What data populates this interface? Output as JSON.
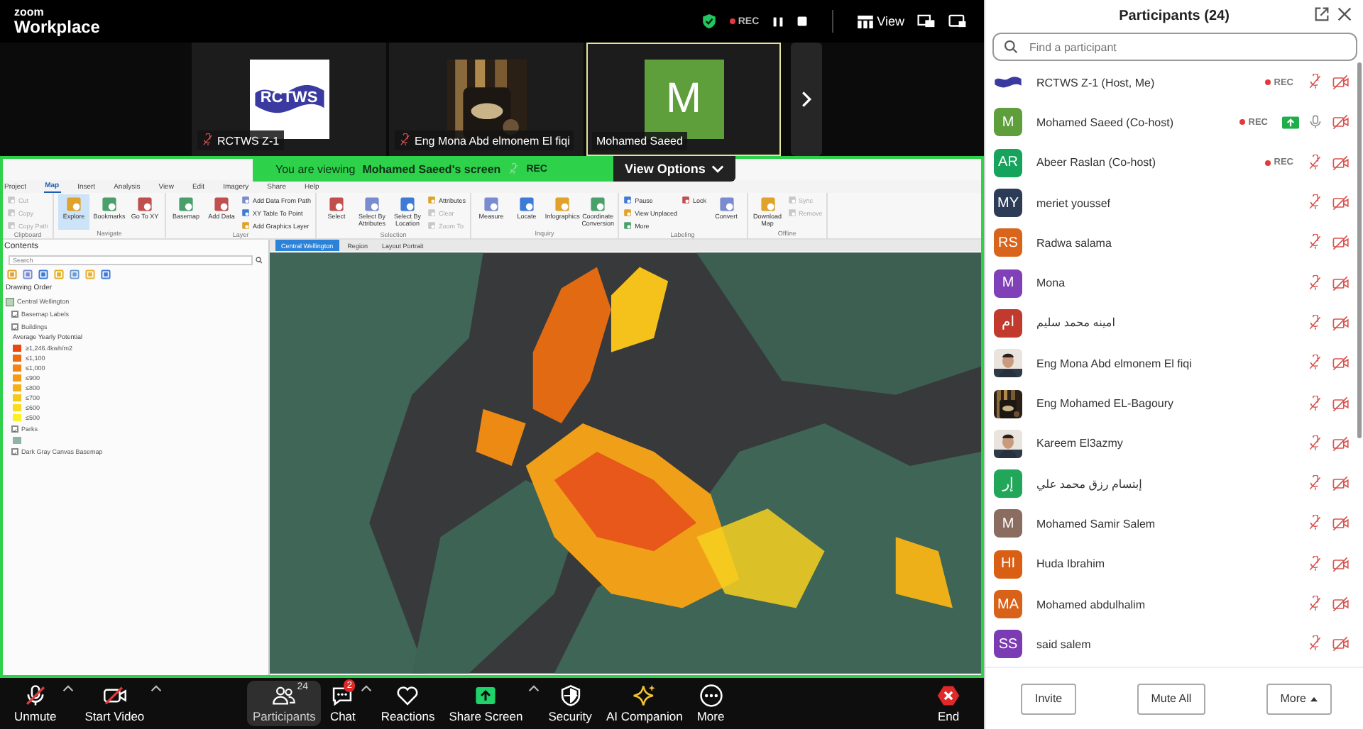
{
  "app": {
    "brand_small": "zoom",
    "brand_large": "Workplace"
  },
  "top_bar": {
    "rec_label": "REC",
    "view_label": "View"
  },
  "video_tiles": [
    {
      "name": "RCTWS Z-1",
      "kind": "logo",
      "logo_text": "RCTWS",
      "muted": true,
      "selected": false
    },
    {
      "name": "Eng Mona Abd elmonem El fiqi",
      "muted": true,
      "selected": false
    },
    {
      "name": "Mohamed Saeed",
      "kind": "initials",
      "initials": "M",
      "color": "#5e9e3b",
      "muted": false,
      "selected": true
    }
  ],
  "share_banner": {
    "prefix": "You are viewing",
    "sharer": "Mohamed Saeed's screen",
    "rec_label": "REC",
    "options_label": "View Options"
  },
  "shared_app": {
    "ribbon_tabs": [
      {
        "label": "Project",
        "selected": false
      },
      {
        "label": "Map",
        "selected": true
      },
      {
        "label": "Insert",
        "selected": false
      },
      {
        "label": "Analysis",
        "selected": false
      },
      {
        "label": "View",
        "selected": false
      },
      {
        "label": "Edit",
        "selected": false
      },
      {
        "label": "Imagery",
        "selected": false
      },
      {
        "label": "Share",
        "selected": false
      },
      {
        "label": "Help",
        "selected": false
      }
    ],
    "ribbon_groups": [
      {
        "label": "Clipboard",
        "items": [
          {
            "label": "Cut",
            "kind": "small",
            "disabled": true,
            "selected": false
          },
          {
            "label": "Copy",
            "kind": "small",
            "disabled": true,
            "selected": false
          },
          {
            "label": "Copy Path",
            "kind": "small",
            "disabled": true,
            "selected": false
          }
        ]
      },
      {
        "label": "Navigate",
        "items": [
          {
            "label": "Explore",
            "kind": "large",
            "disabled": false,
            "selected": true
          },
          {
            "label": "Bookmarks",
            "kind": "large",
            "disabled": false,
            "selected": false
          },
          {
            "label": "Go To XY",
            "kind": "large",
            "disabled": false,
            "selected": false
          }
        ]
      },
      {
        "label": "Layer",
        "items": [
          {
            "label": "Basemap",
            "kind": "large",
            "disabled": false,
            "selected": false
          },
          {
            "label": "Add Data",
            "kind": "large",
            "disabled": false,
            "selected": false
          },
          {
            "label": "Add Data From Path",
            "kind": "small",
            "disabled": false,
            "selected": false
          },
          {
            "label": "XY Table To Point",
            "kind": "small",
            "disabled": false,
            "selected": false
          },
          {
            "label": "Add Graphics Layer",
            "kind": "small",
            "disabled": false,
            "selected": false
          }
        ]
      },
      {
        "label": "Selection",
        "items": [
          {
            "label": "Select",
            "kind": "large",
            "disabled": false,
            "selected": false
          },
          {
            "label": "Select By Attributes",
            "kind": "large",
            "disabled": false,
            "selected": false
          },
          {
            "label": "Select By Location",
            "kind": "large",
            "disabled": false,
            "selected": false
          },
          {
            "label": "Attributes",
            "kind": "small",
            "disabled": false,
            "selected": false
          },
          {
            "label": "Clear",
            "kind": "small",
            "disabled": true,
            "selected": false
          },
          {
            "label": "Zoom To",
            "kind": "small",
            "disabled": true,
            "selected": false
          }
        ]
      },
      {
        "label": "Inquiry",
        "items": [
          {
            "label": "Measure",
            "kind": "large",
            "disabled": false,
            "selected": false
          },
          {
            "label": "Locate",
            "kind": "large",
            "disabled": false,
            "selected": false
          },
          {
            "label": "Infographics",
            "kind": "large",
            "disabled": false,
            "selected": false
          },
          {
            "label": "Coordinate Conversion",
            "kind": "large",
            "disabled": false,
            "selected": false
          }
        ]
      },
      {
        "label": "Labeling",
        "items": [
          {
            "label": "Pause",
            "kind": "small",
            "disabled": false,
            "selected": false
          },
          {
            "label": "View Unplaced",
            "kind": "small",
            "disabled": false,
            "selected": false
          },
          {
            "label": "More",
            "kind": "small",
            "disabled": false,
            "selected": false
          },
          {
            "label": "Lock",
            "kind": "small",
            "disabled": false,
            "selected": false
          },
          {
            "label": "Convert",
            "kind": "large",
            "disabled": false,
            "selected": false
          }
        ]
      },
      {
        "label": "Offline",
        "items": [
          {
            "label": "Download Map",
            "kind": "large",
            "disabled": false,
            "selected": false
          },
          {
            "label": "Sync",
            "kind": "small",
            "disabled": true,
            "selected": false
          },
          {
            "label": "Remove",
            "kind": "small",
            "disabled": true,
            "selected": false
          }
        ]
      }
    ],
    "contents": {
      "title": "Contents",
      "search_placeholder": "Search",
      "heading": "Drawing Order",
      "map_name": "Central Wellington",
      "layers": [
        {
          "name": "Basemap Labels",
          "checked": true
        },
        {
          "name": "Buildings",
          "checked": true,
          "legend_title": "Average Yearly Potential",
          "classes": [
            {
              "label": "≥1,246.4kwh/m2",
              "color": "#e8480f"
            },
            {
              "label": "≤1,100",
              "color": "#ee6a10"
            },
            {
              "label": "≤1,000",
              "color": "#f28413"
            },
            {
              "label": "≤900",
              "color": "#f59a14"
            },
            {
              "label": "≤800",
              "color": "#f6b017"
            },
            {
              "label": "≤700",
              "color": "#f8c819"
            },
            {
              "label": "≤600",
              "color": "#fadc1c"
            },
            {
              "label": "≤500",
              "color": "#fcef22"
            }
          ]
        },
        {
          "name": "Parks",
          "checked": true,
          "classes": [
            {
              "color": "#8fb3a6"
            }
          ]
        },
        {
          "name": "Dark Gray Canvas Basemap",
          "checked": true
        }
      ]
    },
    "map_tabs": [
      {
        "label": "Central Wellington",
        "selected": true
      },
      {
        "label": "Region",
        "selected": false
      },
      {
        "label": "Layout Portrait",
        "selected": false
      }
    ]
  },
  "toolbar": [
    {
      "label": "Unmute",
      "caret": true,
      "selected": false
    },
    {
      "label": "Start Video",
      "caret": true,
      "selected": false
    },
    {
      "label": "Participants",
      "count": "24",
      "selected": true
    },
    {
      "label": "Chat",
      "badge": "2",
      "caret": true,
      "selected": false
    },
    {
      "label": "Reactions",
      "selected": false
    },
    {
      "label": "Share Screen",
      "caret": true,
      "selected": false
    },
    {
      "label": "Security",
      "selected": false
    },
    {
      "label": "AI Companion",
      "selected": false
    },
    {
      "label": "More",
      "selected": false
    },
    {
      "label": "End",
      "selected": false
    }
  ],
  "participants": {
    "title": "Participants (24)",
    "search_placeholder": "Find a participant",
    "rows": [
      {
        "name": "RCTWS Z-1 (Host, Me)",
        "kind": "logo",
        "status_label": "REC",
        "sharing": false,
        "muted": true
      },
      {
        "name": "Mohamed Saeed (Co-host)",
        "kind": "initials",
        "initials": "M",
        "color": "#5e9e3b",
        "status_label": "REC",
        "sharing": true,
        "muted": false
      },
      {
        "name": "Abeer Raslan (Co-host)",
        "kind": "initials",
        "initials": "AR",
        "color": "#16a35c",
        "status_label": "REC",
        "sharing": false,
        "muted": true
      },
      {
        "name": "meriet youssef",
        "kind": "initials",
        "initials": "MY",
        "color": "#2c3c57",
        "sharing": false,
        "muted": true
      },
      {
        "name": "Radwa salama",
        "kind": "initials",
        "initials": "RS",
        "color": "#d9641c",
        "sharing": false,
        "muted": true
      },
      {
        "name": "Mona",
        "kind": "initials",
        "initials": "M",
        "color": "#8040b8",
        "sharing": false,
        "muted": true
      },
      {
        "name": "امينه محمد سليم",
        "kind": "initials",
        "initials": "ام",
        "color": "#c23a2e",
        "sharing": false,
        "muted": true
      },
      {
        "name": "Eng Mona Abd elmonem El fiqi",
        "sharing": false,
        "muted": true
      },
      {
        "name": "Eng Mohamed EL-Bagoury",
        "sharing": false,
        "muted": true
      },
      {
        "name": "Kareem El3azmy",
        "sharing": false,
        "muted": true
      },
      {
        "name": "إبتسام رزق محمد علي",
        "kind": "initials",
        "initials": "إر",
        "color": "#22a75a",
        "sharing": false,
        "muted": true
      },
      {
        "name": "Mohamed Samir Salem",
        "kind": "initials",
        "initials": "M",
        "color": "#8a6c60",
        "sharing": false,
        "muted": true
      },
      {
        "name": "Huda Ibrahim",
        "kind": "initials",
        "initials": "HI",
        "color": "#d95f14",
        "sharing": false,
        "muted": true
      },
      {
        "name": "Mohamed abdulhalim",
        "kind": "initials",
        "initials": "MA",
        "color": "#d8621a",
        "sharing": false,
        "muted": true
      },
      {
        "name": "said salem",
        "kind": "initials",
        "initials": "SS",
        "color": "#7b3bb2",
        "sharing": false,
        "muted": true
      }
    ],
    "buttons": [
      {
        "label": "Invite",
        "caret": false
      },
      {
        "label": "Mute All",
        "caret": false
      },
      {
        "label": "More",
        "caret": true
      }
    ]
  }
}
